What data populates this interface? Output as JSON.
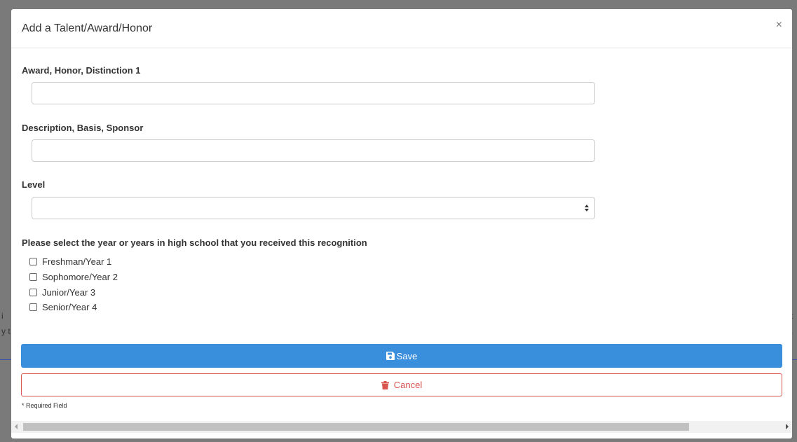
{
  "backdrop": {
    "left_fragments": [
      "i",
      "y t"
    ],
    "right_fragments": [
      "t",
      "."
    ]
  },
  "modal": {
    "title": "Add a Talent/Award/Honor",
    "close_glyph": "×"
  },
  "form": {
    "award_label": "Award, Honor, Distinction 1",
    "award_value": "",
    "description_label": "Description, Basis, Sponsor",
    "description_value": "",
    "level_label": "Level",
    "level_selected": "",
    "years_label": "Please select the year or years in high school that you received this recognition",
    "years": [
      {
        "label": "Freshman/Year 1",
        "checked": false
      },
      {
        "label": "Sophomore/Year 2",
        "checked": false
      },
      {
        "label": "Junior/Year 3",
        "checked": false
      },
      {
        "label": "Senior/Year 4",
        "checked": false
      }
    ]
  },
  "buttons": {
    "save_label": "Save",
    "save_icon": "floppy-disk-icon",
    "cancel_label": "Cancel",
    "cancel_icon": "trash-icon"
  },
  "footer": {
    "required_note": "* Required Field"
  },
  "colors": {
    "primary": "#3a8fdd",
    "danger": "#d9534f"
  }
}
